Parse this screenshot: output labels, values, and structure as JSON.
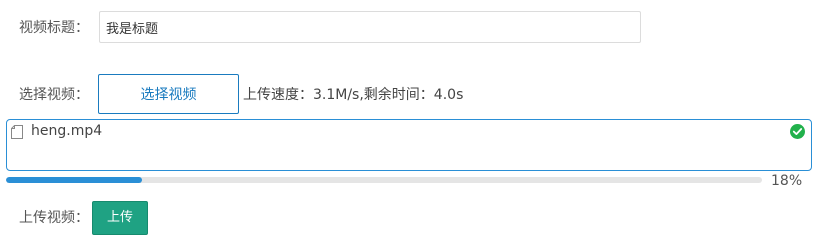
{
  "form": {
    "title_label": "视频标题：",
    "title_value": "我是标题",
    "select_label": "选择视频：",
    "select_button": "选择视频",
    "speed_text": "上传速度：3.1M/s,剩余时间：4.0s",
    "upload_label": "上传视频：",
    "upload_button": "上传"
  },
  "file": {
    "name": "heng.mp4",
    "file_icon": "file-icon",
    "status_icon": "check-circle-icon",
    "progress": 0.18,
    "progress_text": "18%"
  },
  "colors": {
    "accent": "#2a8fd6",
    "success": "#22b14c",
    "upload_button": "#1fa283"
  }
}
